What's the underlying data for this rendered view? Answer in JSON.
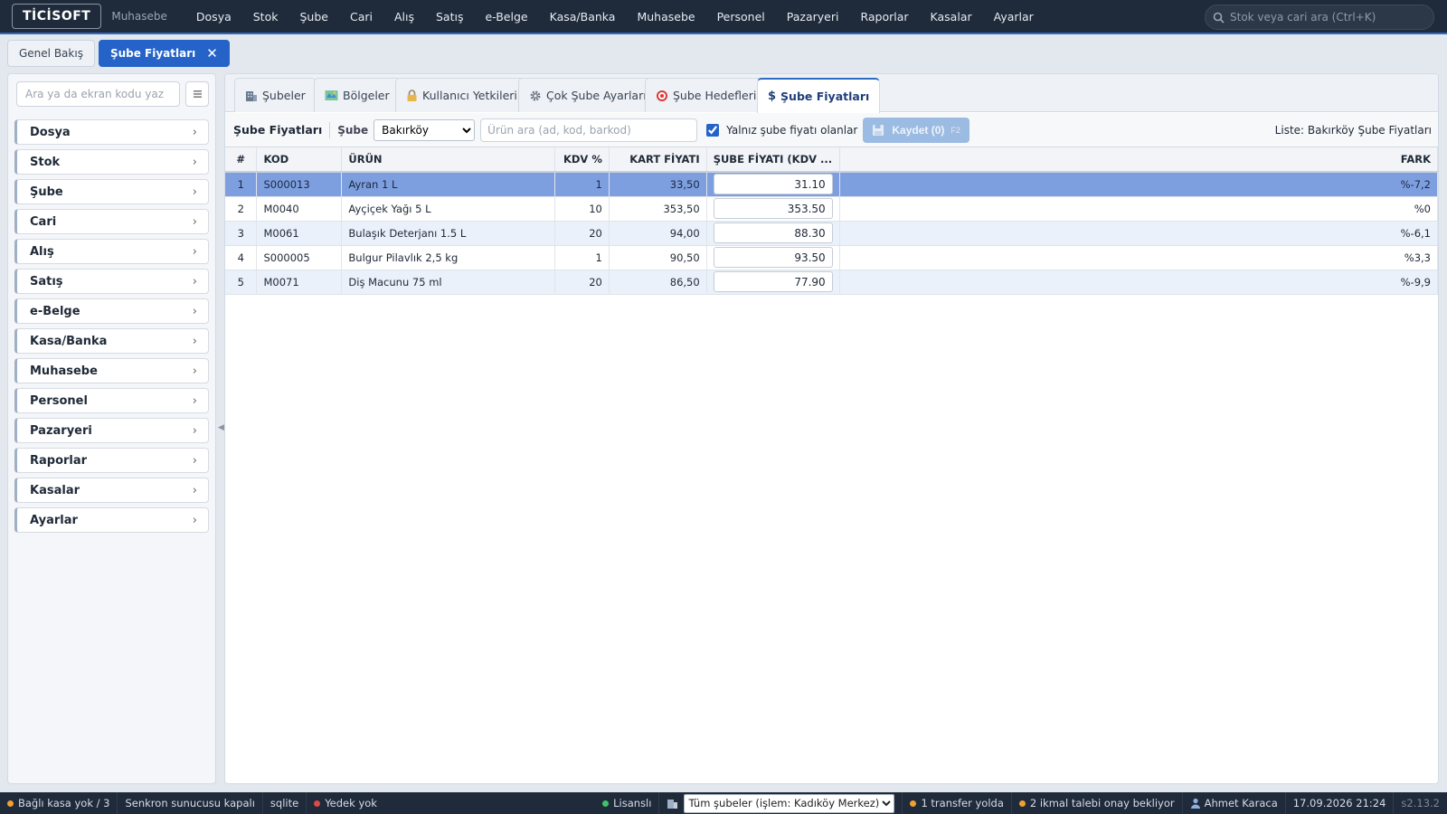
{
  "app": {
    "logo": "TİCİSOFT",
    "module": "Muhasebe",
    "menu": [
      "Dosya",
      "Stok",
      "Şube",
      "Cari",
      "Alış",
      "Satış",
      "e-Belge",
      "Kasa/Banka",
      "Muhasebe",
      "Personel",
      "Pazaryeri",
      "Raporlar",
      "Kasalar",
      "Ayarlar"
    ],
    "search_placeholder": "Stok veya cari ara (Ctrl+K)"
  },
  "doc_tabs": [
    {
      "label": "Genel Bakış",
      "active": false
    },
    {
      "label": "Şube Fiyatları",
      "active": true,
      "close": "✕"
    }
  ],
  "sidebar": {
    "search_placeholder": "Ara ya da ekran kodu yaz",
    "items": [
      "Dosya",
      "Stok",
      "Şube",
      "Cari",
      "Alış",
      "Satış",
      "e-Belge",
      "Kasa/Banka",
      "Muhasebe",
      "Personel",
      "Pazaryeri",
      "Raporlar",
      "Kasalar",
      "Ayarlar"
    ]
  },
  "sub_tabs": [
    {
      "label": "Şubeler",
      "icon": "building-icon"
    },
    {
      "label": "Bölgeler",
      "icon": "map-icon"
    },
    {
      "label": "Kullanıcı Yetkileri",
      "icon": "lock-icon"
    },
    {
      "label": "Çok Şube Ayarları",
      "icon": "gear-icon"
    },
    {
      "label": "Şube Hedefleri",
      "icon": "target-icon"
    },
    {
      "label": "Şube Fiyatları",
      "icon": "dollar-icon",
      "active": true
    }
  ],
  "toolbar": {
    "title": "Şube Fiyatları",
    "branch_label": "Şube",
    "branch_value": "Bakırköy",
    "search_placeholder": "Ürün ara (ad, kod, barkod)",
    "only_branch_label": "Yalnız şube fiyatı olanlar",
    "only_branch_checked": true,
    "save_label": "Kaydet (0)",
    "save_shortcut": "F2",
    "list_label": "Liste: Bakırköy Şube Fiyatları"
  },
  "table": {
    "columns": [
      "#",
      "KOD",
      "ÜRÜN",
      "KDV %",
      "KART FİYATI",
      "ŞUBE FİYATI (KDV ...",
      "FARK"
    ],
    "rows": [
      {
        "no": "1",
        "kod": "S000013",
        "urun": "Ayran 1 L",
        "kdv": "1",
        "kart": "33,50",
        "sube": "31.10",
        "fark": "%-7,2",
        "neg": true,
        "state": "sel"
      },
      {
        "no": "2",
        "kod": "M0040",
        "urun": "Ayçiçek Yağı 5 L",
        "kdv": "10",
        "kart": "353,50",
        "sube": "353.50",
        "fark": "%0",
        "neg": false,
        "state": ""
      },
      {
        "no": "3",
        "kod": "M0061",
        "urun": "Bulaşık Deterjanı 1.5 L",
        "kdv": "20",
        "kart": "94,00",
        "sube": "88.30",
        "fark": "%-6,1",
        "neg": true,
        "state": "alt"
      },
      {
        "no": "4",
        "kod": "S000005",
        "urun": "Bulgur Pilavlık 2,5 kg",
        "kdv": "1",
        "kart": "90,50",
        "sube": "93.50",
        "fark": "%3,3",
        "neg": false,
        "state": ""
      },
      {
        "no": "5",
        "kod": "M0071",
        "urun": "Diş Macunu 75 ml",
        "kdv": "20",
        "kart": "86,50",
        "sube": "77.90",
        "fark": "%-9,9",
        "neg": true,
        "state": "alt"
      }
    ]
  },
  "status": {
    "kasa": "Bağlı kasa yok / 3",
    "sync": "Senkron sunucusu kapalı",
    "db": "sqlite",
    "backup": "Yedek yok",
    "license": "Lisanslı",
    "branch_select": "Tüm şubeler (işlem: Kadıköy Merkez)",
    "transfer": "1 transfer yolda",
    "ikmal": "2 ikmal talebi onay bekliyor",
    "user": "Ahmet Karaca",
    "datetime": "17.09.2026 21:24",
    "version": "s2.13.2"
  },
  "colors": {
    "accent": "#2563c9",
    "topbar": "#1f2a3a",
    "selected_row": "#7e9fdf",
    "negative": "#c0344d"
  }
}
